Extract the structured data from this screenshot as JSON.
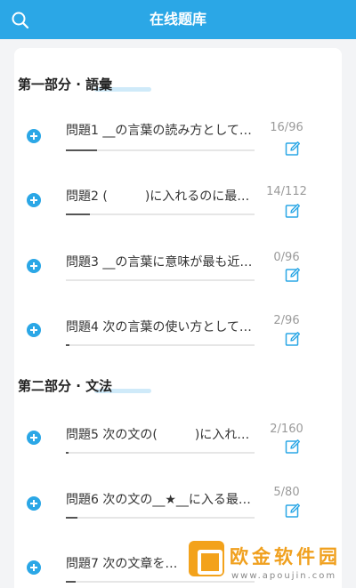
{
  "header": {
    "title": "在线题库",
    "search_icon": "search-icon"
  },
  "sections": [
    {
      "title": "第一部分 · 語彙",
      "items": [
        {
          "label": "問題1 __の言葉の読み方として…",
          "count": "16/96",
          "progress": 0.1667
        },
        {
          "label": "問題2 (　　　)に入れるのに最…",
          "count": "14/112",
          "progress": 0.125
        },
        {
          "label": "問題3 __の言葉に意味が最も近…",
          "count": "0/96",
          "progress": 0
        },
        {
          "label": "問題4 次の言葉の使い方として…",
          "count": "2/96",
          "progress": 0.0208
        }
      ]
    },
    {
      "title": "第二部分 · 文法",
      "items": [
        {
          "label": "問題5 次の文の(　　　)に入れ…",
          "count": "2/160",
          "progress": 0.0125
        },
        {
          "label": "問題6 次の文の__★__に入る最…",
          "count": "5/80",
          "progress": 0.0625
        },
        {
          "label": "問題7 次の文章を…",
          "count": "",
          "progress": 0.05
        }
      ]
    }
  ],
  "watermark": {
    "text": "欧金软件园",
    "sub": "www.apoujin.com"
  },
  "colors": {
    "primary": "#2ba7e6",
    "watermark": "#f0a01e"
  }
}
